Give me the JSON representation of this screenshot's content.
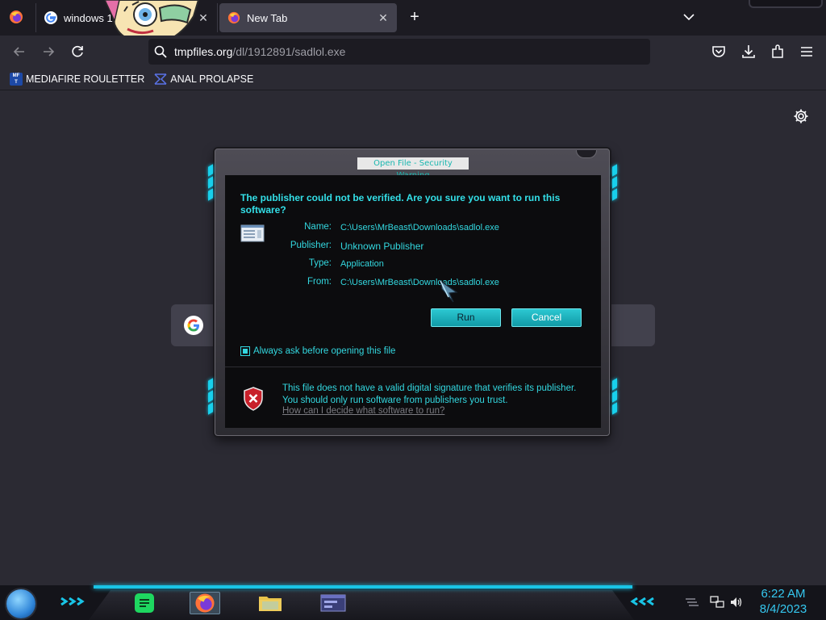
{
  "browser": {
    "tabs": [
      {
        "title": "windows 1",
        "favicon": "google-g-icon",
        "active": false
      },
      {
        "title": "New Tab",
        "favicon": "firefox-icon",
        "active": true
      }
    ],
    "new_tab_icon": "plus-icon",
    "list_all_tabs_icon": "chevron-down-icon"
  },
  "navbar": {
    "url_host": "tmpfiles.org",
    "url_path": "/dl/1912891/sadlol.exe",
    "icons": [
      "back-icon",
      "forward-icon",
      "reload-icon",
      "search-icon",
      "pocket-icon",
      "downloads-icon",
      "extensions-icon",
      "menu-icon"
    ]
  },
  "bookmarks": [
    {
      "label": "MEDIAFIRE ROULETTER",
      "icon": "mediafire-icon",
      "icon_text": "MF\nT"
    },
    {
      "label": "ANAL PROLAPSE",
      "icon": "bookmark-logo-icon"
    }
  ],
  "dialog": {
    "title": "Open File - Security Warning",
    "heading": "The publisher could not be verified.  Are you sure you want to run this software?",
    "fields": [
      {
        "label": "Name:",
        "value": "C:\\Users\\MrBeast\\Downloads\\sadlol.exe"
      },
      {
        "label": "Publisher:",
        "value": "Unknown Publisher"
      },
      {
        "label": "Type:",
        "value": "Application"
      },
      {
        "label": "From:",
        "value": "C:\\Users\\MrBeast\\Downloads\\sadlol.exe"
      }
    ],
    "run_label": "Run",
    "cancel_label": "Cancel",
    "checkbox_label": "Always ask before opening this file",
    "checkbox_checked": true,
    "footer_text": "This file does not have a valid digital signature that verifies its publisher.  You should only run software from publishers you trust.",
    "footer_link": "How can I decide what software to run?"
  },
  "taskbar": {
    "apps": [
      "spotify-icon",
      "firefox-icon",
      "file-explorer-icon",
      "app-window-icon"
    ],
    "time": "6:22 AM",
    "date": "8/4/2023"
  },
  "colors": {
    "accent_cyan": "#33d8e0",
    "browser_bg": "#2b2a33",
    "clock": "#35c8f0"
  }
}
